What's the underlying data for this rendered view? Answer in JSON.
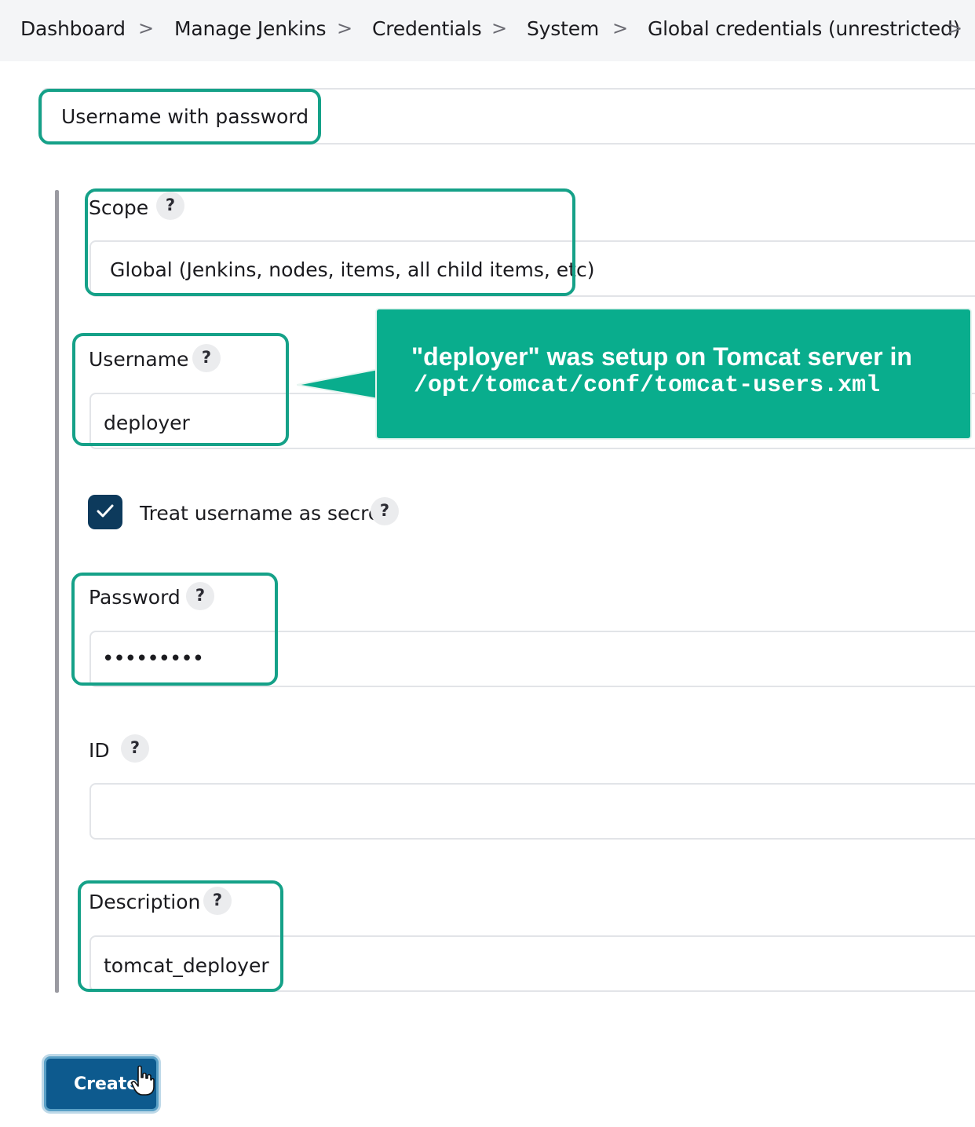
{
  "breadcrumb": {
    "items": [
      "Dashboard",
      "Manage Jenkins",
      "Credentials",
      "System",
      "Global credentials (unrestricted)"
    ],
    "separator": ">"
  },
  "kind": {
    "value": "Username with password"
  },
  "scope": {
    "label": "Scope",
    "value": "Global (Jenkins, nodes, items, all child items, etc)"
  },
  "username": {
    "label": "Username",
    "value": "deployer"
  },
  "treat_secret": {
    "label": "Treat username as secret",
    "checked": true
  },
  "password": {
    "label": "Password",
    "value": "•••••••••"
  },
  "id": {
    "label": "ID",
    "value": ""
  },
  "description": {
    "label": "Description",
    "value": "tomcat_deployer"
  },
  "help_icon": "?",
  "callout": {
    "line1": "\"deployer\"  was setup on Tomcat server in",
    "line2": "/opt/tomcat/conf/tomcat-users.xml"
  },
  "create_button": {
    "label": "Create"
  },
  "colors": {
    "highlight": "#15a188",
    "callout_bg": "#09ad8d",
    "button_bg": "#0d5a8e",
    "checkbox_bg": "#0d3a5c"
  },
  "icons": {
    "checkbox": "check-icon",
    "cursor": "hand-cursor-icon",
    "separator": "chevron-right-icon"
  }
}
